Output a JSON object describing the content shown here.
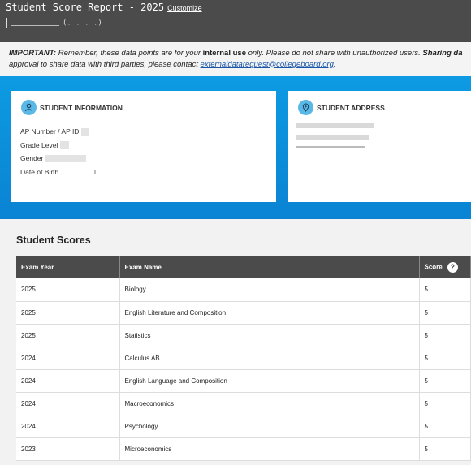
{
  "header": {
    "title": "Student Score Report - 2025",
    "customize_label": "Customize",
    "subtitle_fragment": "(. . . .)"
  },
  "notice": {
    "lead": "IMPORTANT:",
    "text1": " Remember, these data points are for your ",
    "internal": "internal use",
    "text2": " only. Please do not share with unauthorized users. ",
    "sharing": "Sharing da",
    "line2": "approval to share data with third parties, please contact ",
    "email": "externaldatarequest@collegeboard.org",
    "line2_end": "."
  },
  "info_card": {
    "title": "STUDENT INFORMATION",
    "icon": "person-icon",
    "fields": [
      {
        "label": "AP Number / AP ID"
      },
      {
        "label": "Grade Level"
      },
      {
        "label": "Gender"
      },
      {
        "label": "Date of Birth"
      }
    ]
  },
  "address_card": {
    "title": "STUDENT ADDRESS",
    "icon": "location-pin-icon"
  },
  "scores": {
    "title": "Student Scores",
    "columns": [
      "Exam Year",
      "Exam Name",
      "Score"
    ],
    "help_symbol": "?",
    "rows": [
      {
        "year": "2025",
        "exam": "Biology",
        "score": "5"
      },
      {
        "year": "2025",
        "exam": "English Literature and Composition",
        "score": "5"
      },
      {
        "year": "2025",
        "exam": "Statistics",
        "score": "5"
      },
      {
        "year": "2024",
        "exam": "Calculus AB",
        "score": "5"
      },
      {
        "year": "2024",
        "exam": "English Language and Composition",
        "score": "5"
      },
      {
        "year": "2024",
        "exam": "Macroeconomics",
        "score": "5"
      },
      {
        "year": "2024",
        "exam": "Psychology",
        "score": "5"
      },
      {
        "year": "2023",
        "exam": "Microeconomics",
        "score": "5"
      }
    ]
  },
  "colors": {
    "header_bg": "#4b4b4b",
    "band_blue": "#0a8fdc",
    "icon_blue": "#5ab8e6",
    "link": "#1a55a8"
  }
}
